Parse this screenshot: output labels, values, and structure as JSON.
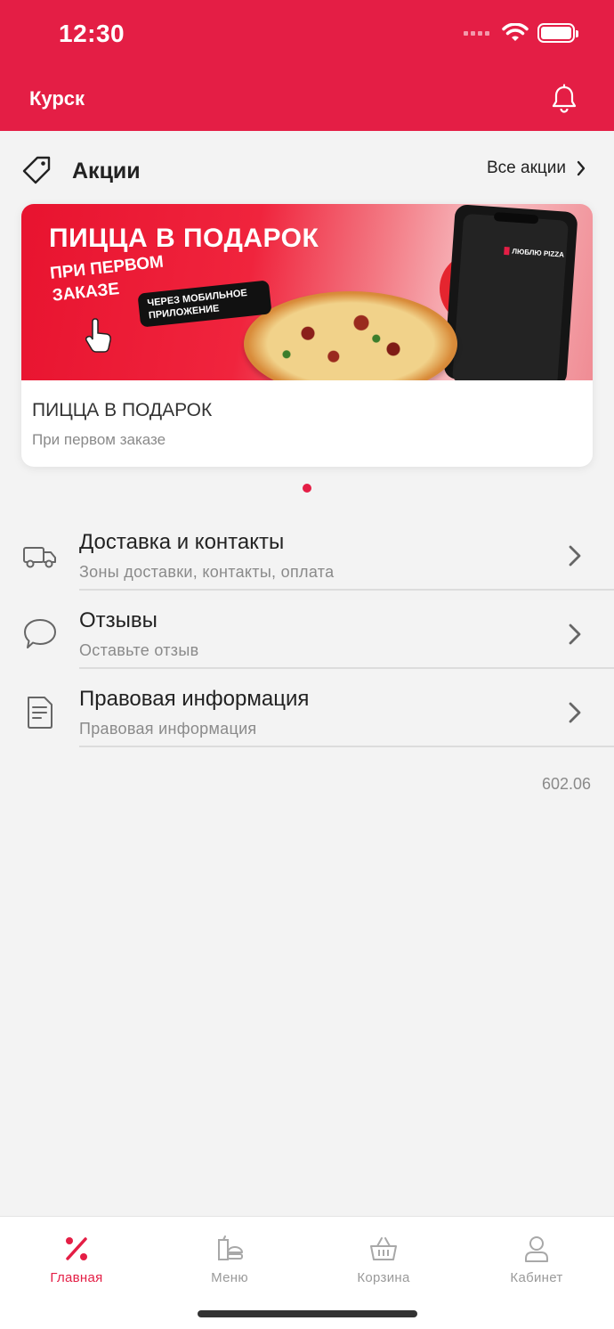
{
  "status_bar": {
    "time": "12:30"
  },
  "header": {
    "city": "Курск"
  },
  "promos": {
    "title": "Акции",
    "all_link": "Все акции",
    "card": {
      "title": "ПИЦЦА В ПОДАРОК",
      "subtitle": "При первом заказе",
      "banner": {
        "headline": "ПИЦЦА В ПОДАРОК",
        "sub": "ПРИ ПЕРВОМ ЗАКАЗЕ",
        "pill": "ЧЕРЕЗ МОБИЛЬНОЕ ПРИЛОЖЕНИЕ",
        "brand": "ЛЮБЛЮ PIZZA"
      }
    }
  },
  "menu_items": [
    {
      "title": "Доставка и контакты",
      "subtitle": "Зоны доставки, контакты, оплата",
      "icon": "truck-icon"
    },
    {
      "title": "Отзывы",
      "subtitle": "Оставьте отзыв",
      "icon": "chat-bubble-icon"
    },
    {
      "title": "Правовая информация",
      "subtitle": "Правовая информация",
      "icon": "document-icon"
    }
  ],
  "version": "602.06",
  "tabbar": {
    "tabs": [
      {
        "label": "Главная",
        "icon": "percent-icon",
        "active": true
      },
      {
        "label": "Меню",
        "icon": "food-menu-icon",
        "active": false
      },
      {
        "label": "Корзина",
        "icon": "basket-icon",
        "active": false
      },
      {
        "label": "Кабинет",
        "icon": "user-icon",
        "active": false
      }
    ]
  },
  "colors": {
    "accent": "#e41e45",
    "background": "#f3f3f3",
    "muted_text": "#8a8a8a"
  }
}
